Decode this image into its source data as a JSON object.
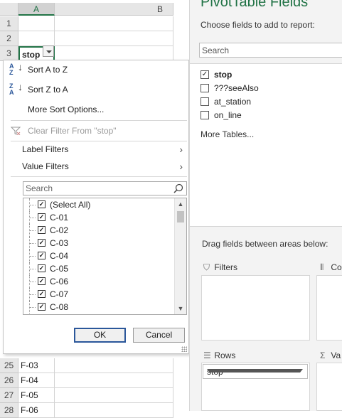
{
  "sheet": {
    "columns": [
      "A",
      "B"
    ],
    "top_rows": [
      {
        "num": "1",
        "a": ""
      },
      {
        "num": "2",
        "a": ""
      },
      {
        "num": "3",
        "a": "stop"
      }
    ],
    "bottom_rows": [
      {
        "num": "25",
        "a": "F-03"
      },
      {
        "num": "26",
        "a": "F-04"
      },
      {
        "num": "27",
        "a": "F-05"
      },
      {
        "num": "28",
        "a": "F-06"
      }
    ]
  },
  "filter_menu": {
    "sort_az": "Sort A to Z",
    "sort_za": "Sort Z to A",
    "more_sort": "More Sort Options...",
    "clear_filter": "Clear Filter From \"stop\"",
    "label_filters": "Label Filters",
    "value_filters": "Value Filters",
    "search_placeholder": "Search",
    "items": [
      {
        "label": "(Select All)",
        "checked": true
      },
      {
        "label": "C-01",
        "checked": true
      },
      {
        "label": "C-02",
        "checked": true
      },
      {
        "label": "C-03",
        "checked": true
      },
      {
        "label": "C-04",
        "checked": true
      },
      {
        "label": "C-05",
        "checked": true
      },
      {
        "label": "C-06",
        "checked": true
      },
      {
        "label": "C-07",
        "checked": true
      },
      {
        "label": "C-08",
        "checked": true
      }
    ],
    "ok": "OK",
    "cancel": "Cancel"
  },
  "pane": {
    "title": "PivotTable Fields",
    "subtitle": "Choose fields to add to report:",
    "search_placeholder": "Search",
    "fields": [
      {
        "label": "stop",
        "checked": true
      },
      {
        "label": "???seeAlso",
        "checked": false
      },
      {
        "label": "at_station",
        "checked": false
      },
      {
        "label": "on_line",
        "checked": false
      }
    ],
    "more_tables": "More Tables...",
    "drag_hint": "Drag fields between areas below:",
    "areas": {
      "filters": "Filters",
      "columns": "Co",
      "rows": "Rows",
      "values": "Va"
    },
    "rows_field": "stop"
  },
  "colors": {
    "accent": "#217346",
    "ok_border": "#2b579a"
  }
}
